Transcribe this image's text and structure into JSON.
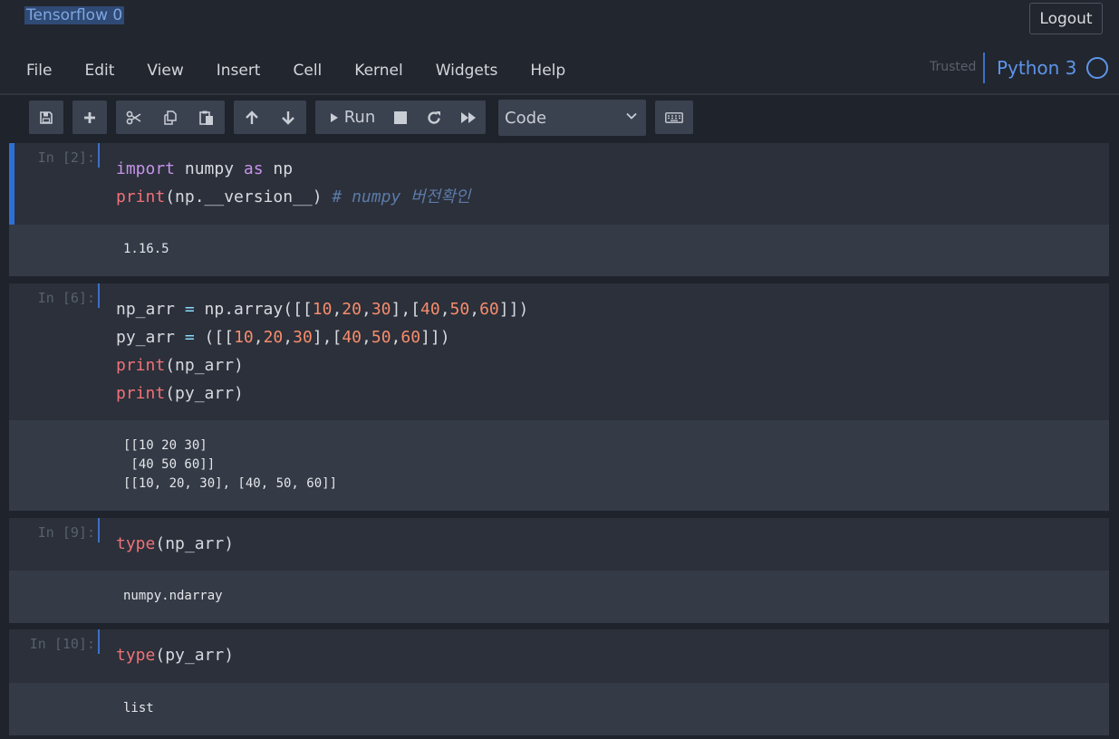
{
  "header": {
    "notebook_title": "Tensorflow 0",
    "logout_label": "Logout",
    "trusted_label": "Trusted",
    "kernel_name": "Python 3"
  },
  "menu": [
    "File",
    "Edit",
    "View",
    "Insert",
    "Cell",
    "Kernel",
    "Widgets",
    "Help"
  ],
  "toolbar": {
    "run_label": "Run",
    "cell_type": "Code",
    "icons": [
      "save-icon",
      "plus-icon",
      "cut-icon",
      "copy-icon",
      "paste-icon",
      "arrow-up-icon",
      "arrow-down-icon",
      "play-icon",
      "stop-icon",
      "restart-icon",
      "fast-forward-icon",
      "keyboard-icon"
    ]
  },
  "cells": [
    {
      "prompt": "In [2]:",
      "code": [
        [
          {
            "t": "import",
            "c": "kw"
          },
          {
            "t": " numpy ",
            "c": ""
          },
          {
            "t": "as",
            "c": "kw"
          },
          {
            "t": " np",
            "c": ""
          }
        ],
        [
          {
            "t": "print",
            "c": "fn"
          },
          {
            "t": "(np.__version__) ",
            "c": ""
          },
          {
            "t": "# numpy 버전확인",
            "c": "cm"
          }
        ]
      ],
      "output": "1.16.5"
    },
    {
      "prompt": "In [6]:",
      "code": [
        [
          {
            "t": "np_arr ",
            "c": ""
          },
          {
            "t": "=",
            "c": "op"
          },
          {
            "t": " np.array([[",
            "c": ""
          },
          {
            "t": "10",
            "c": "num"
          },
          {
            "t": ",",
            "c": ""
          },
          {
            "t": "20",
            "c": "num"
          },
          {
            "t": ",",
            "c": ""
          },
          {
            "t": "30",
            "c": "num"
          },
          {
            "t": "],[",
            "c": ""
          },
          {
            "t": "40",
            "c": "num"
          },
          {
            "t": ",",
            "c": ""
          },
          {
            "t": "50",
            "c": "num"
          },
          {
            "t": ",",
            "c": ""
          },
          {
            "t": "60",
            "c": "num"
          },
          {
            "t": "]])",
            "c": ""
          }
        ],
        [
          {
            "t": "py_arr ",
            "c": ""
          },
          {
            "t": "=",
            "c": "op"
          },
          {
            "t": " ([[",
            "c": ""
          },
          {
            "t": "10",
            "c": "num"
          },
          {
            "t": ",",
            "c": ""
          },
          {
            "t": "20",
            "c": "num"
          },
          {
            "t": ",",
            "c": ""
          },
          {
            "t": "30",
            "c": "num"
          },
          {
            "t": "],[",
            "c": ""
          },
          {
            "t": "40",
            "c": "num"
          },
          {
            "t": ",",
            "c": ""
          },
          {
            "t": "50",
            "c": "num"
          },
          {
            "t": ",",
            "c": ""
          },
          {
            "t": "60",
            "c": "num"
          },
          {
            "t": "]])",
            "c": ""
          }
        ],
        [
          {
            "t": "print",
            "c": "fn"
          },
          {
            "t": "(np_arr)",
            "c": ""
          }
        ],
        [
          {
            "t": "print",
            "c": "fn"
          },
          {
            "t": "(py_arr)",
            "c": ""
          }
        ]
      ],
      "output": "[[10 20 30]\n [40 50 60]]\n[[10, 20, 30], [40, 50, 60]]"
    },
    {
      "prompt": "In [9]:",
      "code": [
        [
          {
            "t": "type",
            "c": "fn"
          },
          {
            "t": "(np_arr)",
            "c": ""
          }
        ]
      ],
      "output": "numpy.ndarray"
    },
    {
      "prompt": "In [10]:",
      "code": [
        [
          {
            "t": "type",
            "c": "fn"
          },
          {
            "t": "(py_arr)",
            "c": ""
          }
        ]
      ],
      "output": "list"
    }
  ]
}
